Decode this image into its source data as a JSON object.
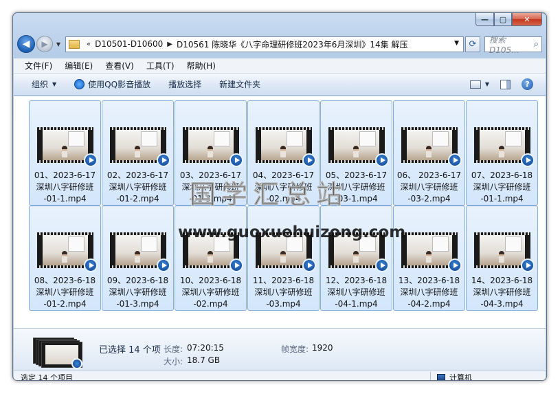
{
  "window": {
    "caption_buttons": {
      "minimize": "—",
      "maximize": "▢",
      "close": "✕"
    }
  },
  "nav": {
    "breadcrumb_prefix": "«",
    "crumbs": [
      "D10501-D10600",
      "D10561 陈晓华《八字命理研修班2023年6月深圳》14集 解压"
    ],
    "search_placeholder": "搜索 D105..."
  },
  "menu": [
    "文件(F)",
    "编辑(E)",
    "查看(V)",
    "工具(T)",
    "帮助(H)"
  ],
  "toolbar": {
    "organize": "组织",
    "qq_play": "使用QQ影音播放",
    "play_selection": "播放选择",
    "new_folder": "新建文件夹",
    "help": "?"
  },
  "files": [
    {
      "line1": "01、2023-6-17",
      "line2": "深圳八字研修班",
      "line3": "-01-1.mp4"
    },
    {
      "line1": "02、2023-6-17",
      "line2": "深圳八字研修班",
      "line3": "-01-2.mp4"
    },
    {
      "line1": "03、2023-6-17",
      "line2": "深圳八字研修班",
      "line3": "-01-3.mp4"
    },
    {
      "line1": "04、2023-6-17",
      "line2": "深圳八字研修班",
      "line3": "-02.mp4"
    },
    {
      "line1": "05、2023-6-17",
      "line2": "深圳八字研修班",
      "line3": "-03-1.mp4"
    },
    {
      "line1": "06、 2023-6-17",
      "line2": "深圳八字研修班",
      "line3": "-03-2.mp4"
    },
    {
      "line1": "07、2023-6-18",
      "line2": "深圳八字研修班",
      "line3": "-01-1.mp4"
    },
    {
      "line1": "08、2023-6-18",
      "line2": "深圳八字研修班",
      "line3": "-01-2.mp4"
    },
    {
      "line1": "09、2023-6-18",
      "line2": "深圳八字研修班",
      "line3": "-01-3.mp4"
    },
    {
      "line1": "10、2023-6-18",
      "line2": "深圳八字研修班",
      "line3": "-02.mp4"
    },
    {
      "line1": "11、2023-6-18",
      "line2": "深圳八字研修班",
      "line3": "-03.mp4"
    },
    {
      "line1": "12、2023-6-18",
      "line2": "深圳八字研修班",
      "line3": "-04-1.mp4"
    },
    {
      "line1": "13、2023-6-18",
      "line2": "深圳八字研修班",
      "line3": "-04-2.mp4"
    },
    {
      "line1": "14、2023-6-18",
      "line2": "深圳八字研修班",
      "line3": "-04-3.mp4"
    }
  ],
  "watermark": {
    "cn": "国学汇总站",
    "url": "www.guoxuehuizong.com"
  },
  "details": {
    "selected": "已选择 14 个项",
    "length_label": "长度:",
    "length_value": "07:20:15",
    "size_label": "大小:",
    "size_value": "18.7 GB",
    "width_label": "帧宽度:",
    "width_value": "1920"
  },
  "status": {
    "left": "选定 14 个项目",
    "right": "计算机"
  },
  "colors": {
    "accent": "#3399ff",
    "selection": "#d3e6fb",
    "selection_border": "#84acdd"
  }
}
